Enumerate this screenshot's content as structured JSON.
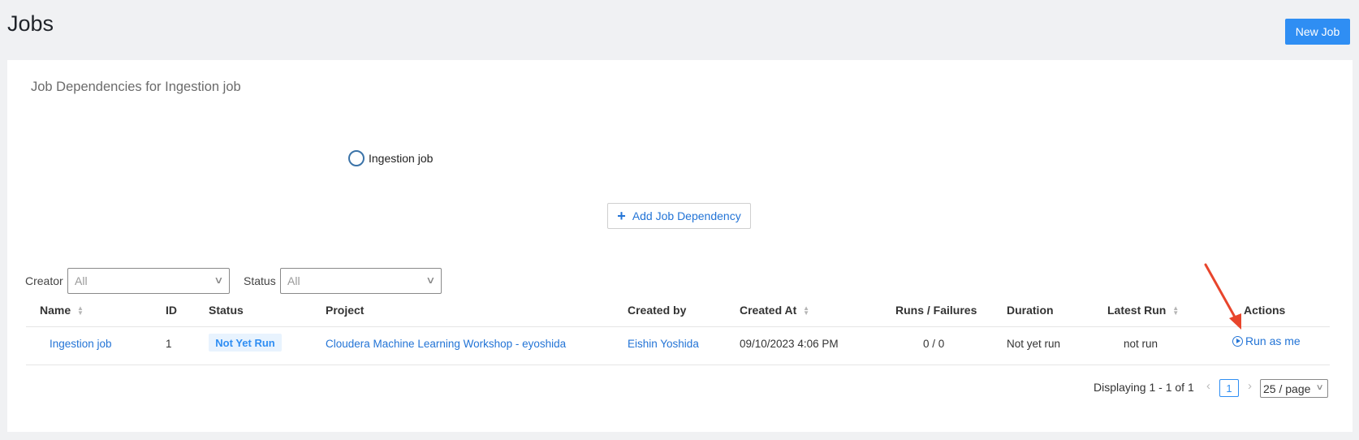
{
  "header": {
    "title": "Jobs",
    "new_job_label": "New Job"
  },
  "dependencies": {
    "title": "Job Dependencies for Ingestion job",
    "node_label": "Ingestion job",
    "add_button_label": "Add Job Dependency"
  },
  "filters": {
    "creator_label": "Creator",
    "creator_value": "All",
    "status_label": "Status",
    "status_value": "All"
  },
  "table": {
    "columns": [
      "Name",
      "ID",
      "Status",
      "Project",
      "Created by",
      "Created At",
      "Runs / Failures",
      "Duration",
      "Latest Run",
      "Actions"
    ],
    "rows": [
      {
        "name": "Ingestion job",
        "id": "1",
        "status": "Not Yet Run",
        "project": "Cloudera Machine Learning Workshop - eyoshida",
        "created_by": "Eishin Yoshida",
        "created_at": "09/10/2023 4:06 PM",
        "runs_failures": "0 / 0",
        "duration": "Not yet run",
        "latest_run": "not run",
        "action_label": "Run as me"
      }
    ]
  },
  "pagination": {
    "summary": "Displaying 1 - 1 of 1",
    "current_page": "1",
    "page_size": "25 / page"
  },
  "colors": {
    "primary": "#2f8ef3",
    "link": "#2374d6",
    "annotation_arrow": "#e8452c"
  }
}
